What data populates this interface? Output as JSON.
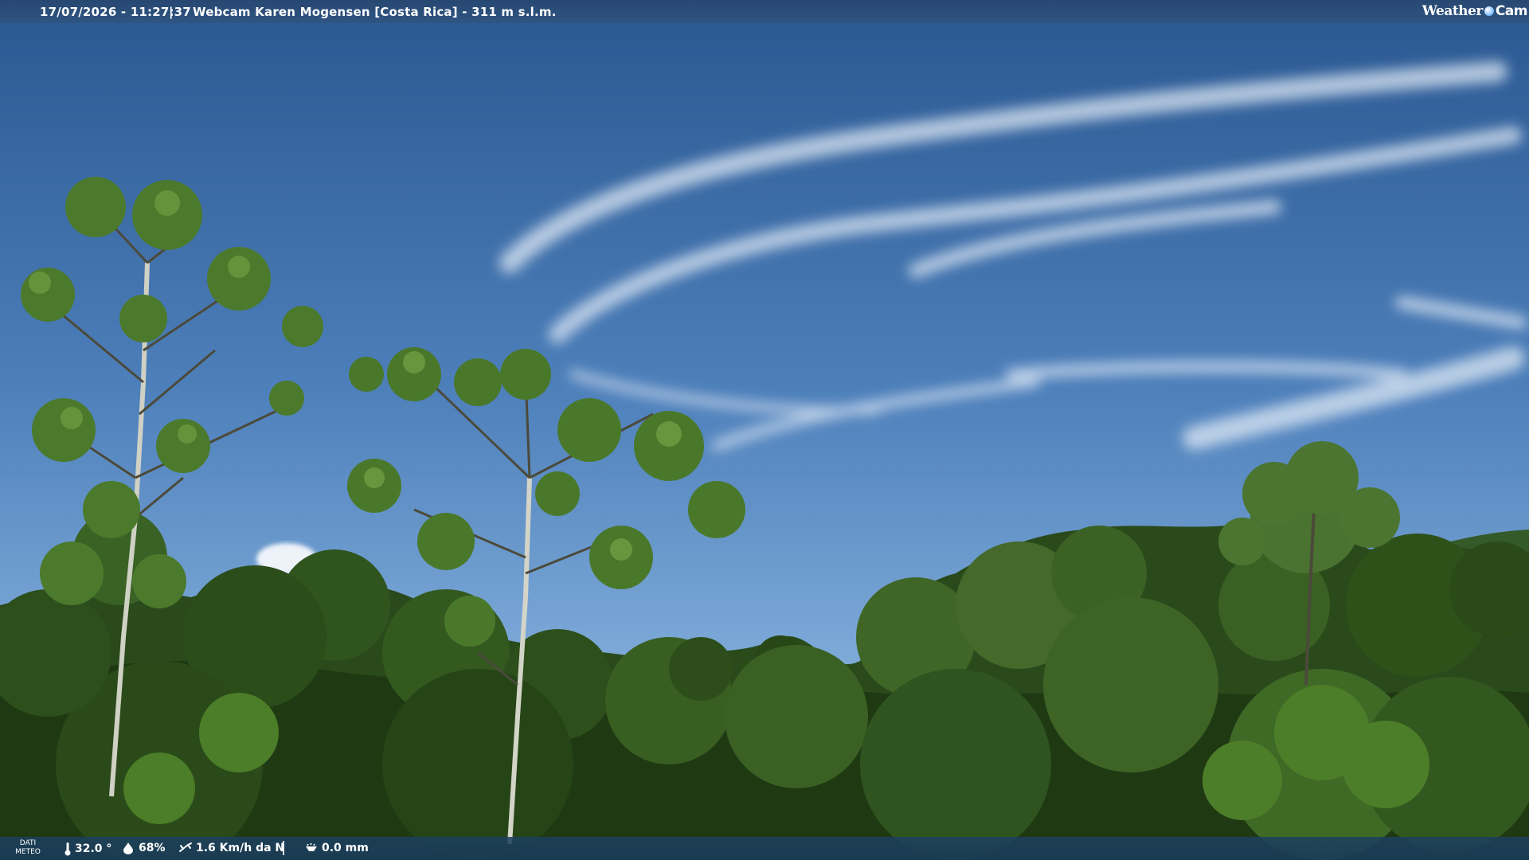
{
  "overlay": {
    "timestamp": "17/07/2026 - 11:27:37",
    "separator": "|",
    "title": "Webcam Karen Mogensen [Costa Rica]  - 311 m s.l.m.",
    "logo": {
      "part1": "Weather",
      "part2": "Cam",
      "icon": "globe-icon"
    }
  },
  "weather": {
    "label": "DATI METEO",
    "temperature": "32.0 °",
    "humidity": "68%",
    "wind": "1.6 Km/h da N",
    "rain": "0.0 mm",
    "icons": {
      "temperature": "thermometer-icon",
      "humidity": "droplet-icon",
      "wind": "wind-icon",
      "rain": "rain-gauge-icon"
    }
  },
  "colors": {
    "sky_top": "#2b5b95",
    "sky_horizon": "#7aa8d4",
    "foliage_dark": "#1d3b12",
    "foliage_light": "#4f7a2a",
    "overlay_bar": "#26466e"
  }
}
